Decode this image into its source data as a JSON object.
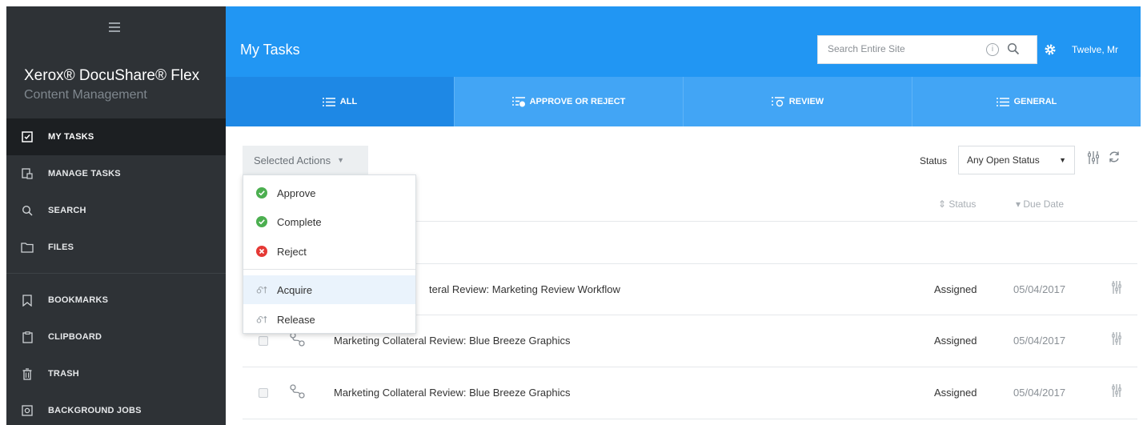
{
  "sidebar": {
    "brand": "Xerox® DocuShare® Flex",
    "subtitle": "Content Management",
    "items": [
      {
        "label": "MY TASKS",
        "icon": "checkbox-icon"
      },
      {
        "label": "MANAGE TASKS",
        "icon": "manage-tasks-icon"
      },
      {
        "label": "SEARCH",
        "icon": "search-icon"
      },
      {
        "label": "FILES",
        "icon": "folder-icon"
      },
      {
        "label": "BOOKMARKS",
        "icon": "bookmark-icon"
      },
      {
        "label": "CLIPBOARD",
        "icon": "clipboard-icon"
      },
      {
        "label": "TRASH",
        "icon": "trash-icon"
      },
      {
        "label": "BACKGROUND JOBS",
        "icon": "background-jobs-icon"
      }
    ]
  },
  "header": {
    "title": "My Tasks",
    "search_placeholder": "Search Entire Site",
    "user": "Twelve, Mr"
  },
  "tabs": [
    {
      "label": "ALL"
    },
    {
      "label": "APPROVE OR REJECT"
    },
    {
      "label": "REVIEW"
    },
    {
      "label": "GENERAL"
    }
  ],
  "toolbar": {
    "selected_actions": "Selected Actions",
    "status_label": "Status",
    "status_value": "Any Open Status"
  },
  "columns": {
    "status": "Status",
    "due_date": "Due Date"
  },
  "rows": [
    {
      "title": "Marketing Collateral Review: Marketing Review Workflow",
      "visible_title": "teral Review: Marketing Review Workflow",
      "status": "Assigned",
      "due": "05/04/2017"
    },
    {
      "title": "Marketing Collateral Review: Blue Breeze Graphics",
      "visible_title": "Marketing Collateral Review: Blue Breeze Graphics",
      "status": "Assigned",
      "due": "05/04/2017"
    },
    {
      "title": "Marketing Collateral Review: Blue Breeze Graphics",
      "visible_title": "Marketing Collateral Review: Blue Breeze Graphics",
      "status": "Assigned",
      "due": "05/04/2017"
    }
  ],
  "menu": [
    {
      "label": "Approve",
      "icon": "check-circle-icon"
    },
    {
      "label": "Complete",
      "icon": "check-circle-icon"
    },
    {
      "label": "Reject",
      "icon": "x-circle-icon"
    },
    {
      "label": "Acquire",
      "icon": "acquire-icon"
    },
    {
      "label": "Release",
      "icon": "release-icon"
    }
  ],
  "colors": {
    "header": "#2196f3",
    "tabs": "#42a5f5",
    "tab_active": "#1e88e5",
    "sidebar": "#2e3236",
    "approve": "#4caf50",
    "reject": "#e53935"
  }
}
